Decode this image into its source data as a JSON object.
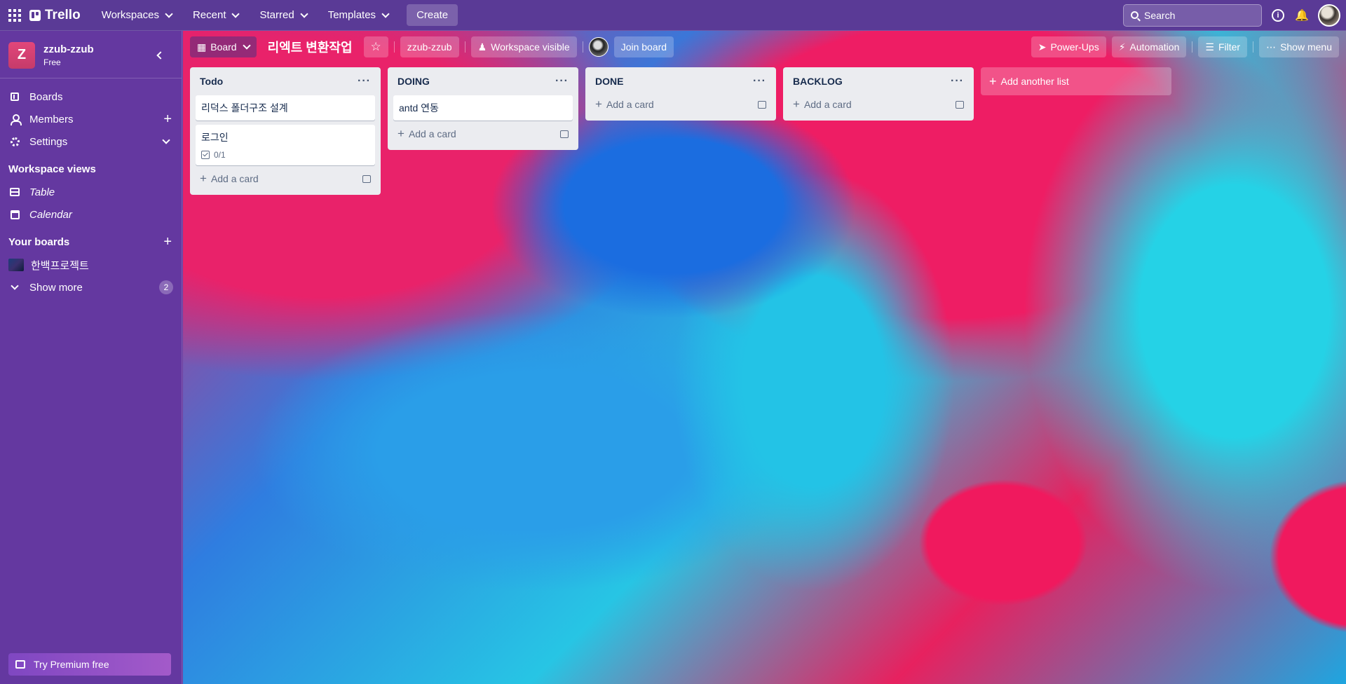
{
  "header": {
    "logo": "Trello",
    "nav": [
      "Workspaces",
      "Recent",
      "Starred",
      "Templates"
    ],
    "create": "Create",
    "search_placeholder": "Search"
  },
  "sidebar": {
    "workspace_initial": "Z",
    "workspace_name": "zzub-zzub",
    "plan": "Free",
    "items": [
      {
        "label": "Boards"
      },
      {
        "label": "Members"
      },
      {
        "label": "Settings"
      }
    ],
    "views_title": "Workspace views",
    "views": [
      {
        "label": "Table"
      },
      {
        "label": "Calendar"
      }
    ],
    "boards_title": "Your boards",
    "boards": [
      {
        "label": "한백프로젝트"
      }
    ],
    "show_more": "Show more",
    "show_more_count": "2",
    "premium": "Try Premium free"
  },
  "board": {
    "view_btn": "Board",
    "title": "리엑트 변환작업",
    "workspace_btn": "zzub-zzub",
    "visibility": "Workspace visible",
    "join": "Join board",
    "powerups": "Power-Ups",
    "automation": "Automation",
    "filter": "Filter",
    "show_menu": "Show menu"
  },
  "lists": [
    {
      "title": "Todo",
      "cards": [
        {
          "title": "리덕스 폴더구조 설계"
        },
        {
          "title": "로그인",
          "checklist": "0/1"
        }
      ],
      "add": "Add a card"
    },
    {
      "title": "DOING",
      "cards": [
        {
          "title": "antd 연동"
        }
      ],
      "add": "Add a card"
    },
    {
      "title": "DONE",
      "cards": [],
      "add": "Add a card"
    },
    {
      "title": "BACKLOG",
      "cards": [],
      "add": "Add a card"
    }
  ],
  "add_list": "Add another list"
}
